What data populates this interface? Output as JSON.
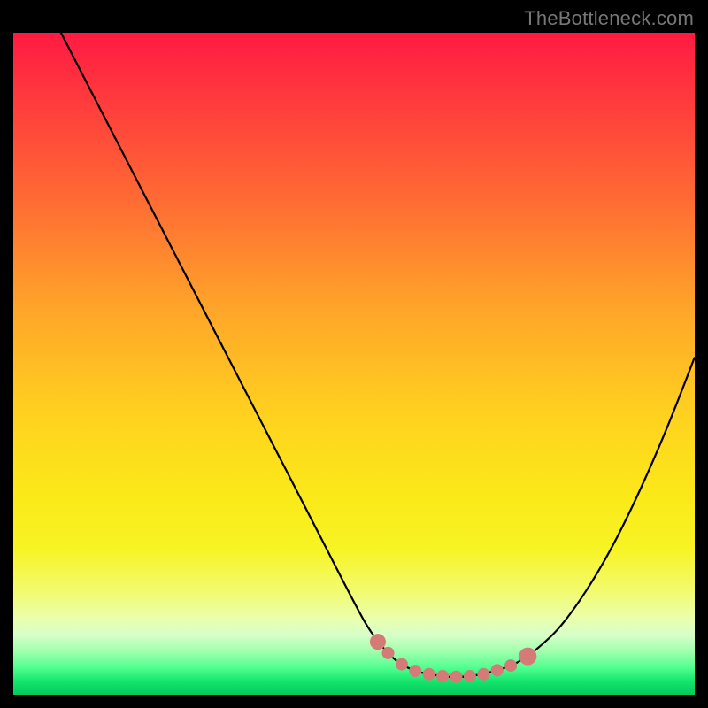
{
  "watermark": {
    "text": "TheBottleneck.com"
  },
  "chart_data": {
    "type": "line",
    "title": "",
    "xlabel": "",
    "ylabel": "",
    "xlim": [
      0,
      100
    ],
    "ylim": [
      0,
      100
    ],
    "series": [
      {
        "name": "left-curve",
        "x": [
          7,
          10,
          15,
          20,
          25,
          30,
          35,
          40,
          45,
          50,
          52.5,
          55,
          57,
          59,
          61
        ],
        "values": [
          100,
          94,
          84,
          74,
          64,
          54,
          44,
          34,
          24,
          14,
          9.5,
          6.3,
          4.6,
          3.6,
          3.1
        ]
      },
      {
        "name": "flat-bottom",
        "x": [
          55,
          58,
          61,
          64,
          67,
          70,
          73,
          75
        ],
        "values": [
          6.3,
          4.6,
          3.1,
          2.7,
          2.8,
          3.4,
          4.4,
          5.5
        ]
      },
      {
        "name": "right-curve",
        "x": [
          73,
          76,
          80,
          84,
          88,
          92,
          96,
          100
        ],
        "values": [
          4.4,
          6.2,
          10.0,
          15.6,
          22.6,
          31.0,
          40.5,
          51.0
        ]
      }
    ],
    "markers": {
      "name": "bottom-dots",
      "color": "#d67a78",
      "x": [
        53.5,
        55,
        57,
        59,
        61,
        63,
        65,
        67,
        69,
        71,
        73,
        75.5
      ],
      "values": [
        8.0,
        6.3,
        4.6,
        3.6,
        3.1,
        2.8,
        2.7,
        2.8,
        3.1,
        3.7,
        4.4,
        5.8
      ],
      "radii": [
        9,
        7,
        7,
        7,
        7,
        7,
        7,
        7,
        7,
        7,
        7,
        10
      ]
    },
    "gradient_stops": [
      {
        "pos": 0,
        "color": "#ff1a43"
      },
      {
        "pos": 0.5,
        "color": "#ffd21f"
      },
      {
        "pos": 0.9,
        "color": "#eaffad"
      },
      {
        "pos": 1.0,
        "color": "#06c95d"
      }
    ]
  }
}
